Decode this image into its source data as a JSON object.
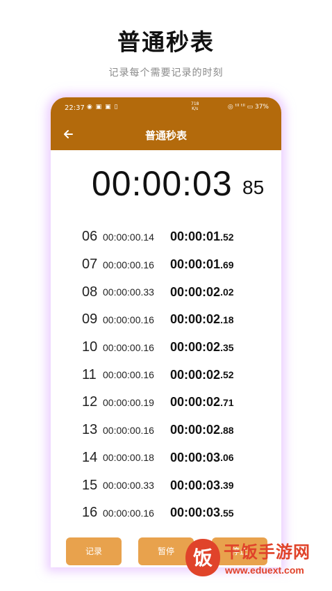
{
  "promo": {
    "title": "普通秒表",
    "subtitle": "记录每个需要记录的时刻"
  },
  "status": {
    "time": "22:37",
    "left_icons": "◉ ▣ ▣ ▯",
    "net_speed_value": "718",
    "net_speed_unit": "K/s",
    "right_icons": "◎ ᵗˡˡ ᵗˡˡ",
    "battery": "37%"
  },
  "appbar": {
    "title": "普通秒表"
  },
  "timer": {
    "main": "00:00:03",
    "centis": "85"
  },
  "laps": [
    {
      "num": "06",
      "split": "00:00:00.14",
      "total": "00:00:01",
      "total_cs": ".52"
    },
    {
      "num": "07",
      "split": "00:00:00.16",
      "total": "00:00:01",
      "total_cs": ".69"
    },
    {
      "num": "08",
      "split": "00:00:00.33",
      "total": "00:00:02",
      "total_cs": ".02"
    },
    {
      "num": "09",
      "split": "00:00:00.16",
      "total": "00:00:02",
      "total_cs": ".18"
    },
    {
      "num": "10",
      "split": "00:00:00.16",
      "total": "00:00:02",
      "total_cs": ".35"
    },
    {
      "num": "11",
      "split": "00:00:00.16",
      "total": "00:00:02",
      "total_cs": ".52"
    },
    {
      "num": "12",
      "split": "00:00:00.19",
      "total": "00:00:02",
      "total_cs": ".71"
    },
    {
      "num": "13",
      "split": "00:00:00.16",
      "total": "00:00:02",
      "total_cs": ".88"
    },
    {
      "num": "14",
      "split": "00:00:00.18",
      "total": "00:00:03",
      "total_cs": ".06"
    },
    {
      "num": "15",
      "split": "00:00:00.33",
      "total": "00:00:03",
      "total_cs": ".39"
    },
    {
      "num": "16",
      "split": "00:00:00.16",
      "total": "00:00:03",
      "total_cs": ".55"
    }
  ],
  "buttons": {
    "record": "记录",
    "pause": "暂停",
    "stop": "停止"
  },
  "watermark": {
    "text": "干饭手游网",
    "url": "www.eduext.com",
    "logo_char": "饭"
  },
  "colors": {
    "appbar": "#b36a0c",
    "button": "#e8a24d",
    "watermark": "#e0432a",
    "glow": "#dcaaff"
  }
}
